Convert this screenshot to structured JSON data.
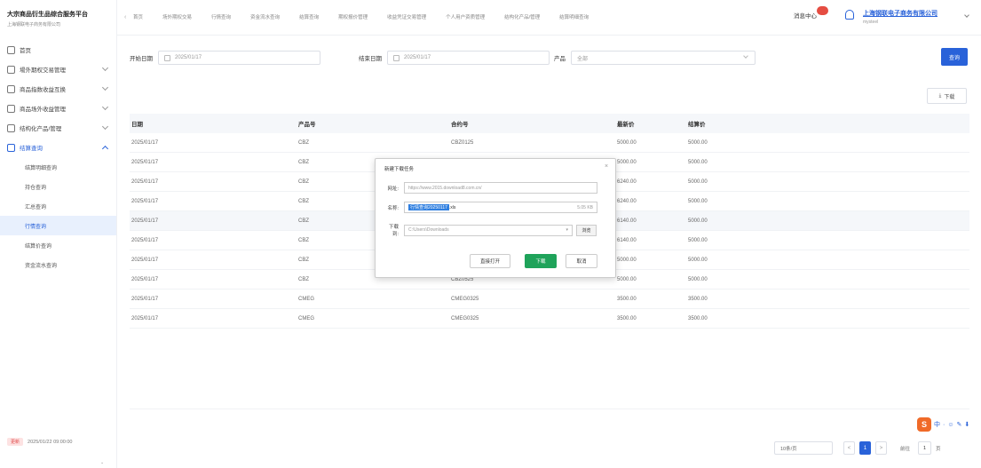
{
  "sidebar": {
    "brand_title": "大宗商品衍生品综合服务平台",
    "brand_subtitle": "上海钢联电子商务有限公司",
    "menu": [
      {
        "label": "首页",
        "expand": false
      },
      {
        "label": "場外期权交易管理",
        "expand": true
      },
      {
        "label": "商品指数收益互换",
        "expand": true
      },
      {
        "label": "商品场外收益管理",
        "expand": true
      },
      {
        "label": "结构化产品/管理",
        "expand": true
      },
      {
        "label": "结算查询",
        "expand": true,
        "open": true
      }
    ],
    "submenu": [
      {
        "label": "结算明细查询",
        "active": false
      },
      {
        "label": "持仓查询",
        "active": false
      },
      {
        "label": "汇总查询",
        "active": false
      },
      {
        "label": "行情查询",
        "active": true
      },
      {
        "label": "结算价查询",
        "active": false
      },
      {
        "label": "资金流水查询",
        "active": false
      }
    ],
    "footer_badge": "更新",
    "footer_time": "2025/01/22 09:00:00"
  },
  "topbar": {
    "tabs": [
      "首页",
      "场外期权交易",
      "行情查询",
      "资金流水查询",
      "结算查询",
      "期权报价管理",
      "收益凭证交易管理",
      "个人用户资质管理",
      "结构化产品/管理",
      "结算明细查询"
    ],
    "help_label": "消息中心",
    "company": "上海钢联电子商务有限公司",
    "company_sub": "mysteel"
  },
  "filters": {
    "start_label": "开始日期",
    "start_value": "2025/01/17",
    "end_label": "结束日期",
    "end_value": "2025/01/17",
    "product_label": "产品",
    "product_placeholder": "全部",
    "query_button": "查询",
    "download_button": "下载"
  },
  "table": {
    "columns": [
      "日期",
      "产品号",
      "合约号",
      "最新价",
      "结算价"
    ],
    "rows": [
      [
        "2025/01/17",
        "CBZ",
        "CBZ0125",
        "5000.00",
        "5000.00"
      ],
      [
        "2025/01/17",
        "CBZ",
        "",
        "5000.00",
        "5000.00"
      ],
      [
        "2025/01/17",
        "CBZ",
        "",
        "6240.00",
        "5000.00"
      ],
      [
        "2025/01/17",
        "CBZ",
        "",
        "6240.00",
        "5000.00"
      ],
      [
        "2025/01/17",
        "CBZ",
        "",
        "6140.00",
        "5000.00"
      ],
      [
        "2025/01/17",
        "CBZ",
        "",
        "6140.00",
        "5000.00"
      ],
      [
        "2025/01/17",
        "CBZ",
        "",
        "5000.00",
        "5000.00"
      ],
      [
        "2025/01/17",
        "CBZ",
        "CBZ0525",
        "5000.00",
        "5000.00"
      ],
      [
        "2025/01/17",
        "CMEG",
        "CMEG0325",
        "3500.00",
        "3500.00"
      ],
      [
        "2025/01/17",
        "CMEG",
        "CMEG0325",
        "3500.00",
        "3500.00"
      ]
    ],
    "highlighted_row": 4
  },
  "pagination": {
    "page_size": "10条/页",
    "prev": "<",
    "current": "1",
    "next": ">",
    "goto_label": "前往",
    "goto_value": "1",
    "goto_unit": "页"
  },
  "ime": {
    "logo": "S",
    "icons": [
      "中",
      "·",
      "☺",
      "✎",
      "⬇"
    ]
  },
  "dialog": {
    "title": "新建下载任务",
    "close": "×",
    "url_label": "网址:",
    "url_value": "https://www.2015.download8.com.cn/",
    "name_label": "名称:",
    "name_value": "行情查询20250117",
    "name_ext": ".xls",
    "size_value": "5.05 KB",
    "dir_label": "下载到:",
    "dir_value": "C:\\Users\\Downloads",
    "browse": "浏览",
    "btn_open": "直接打开",
    "btn_download": "下载",
    "btn_cancel": "取消"
  }
}
